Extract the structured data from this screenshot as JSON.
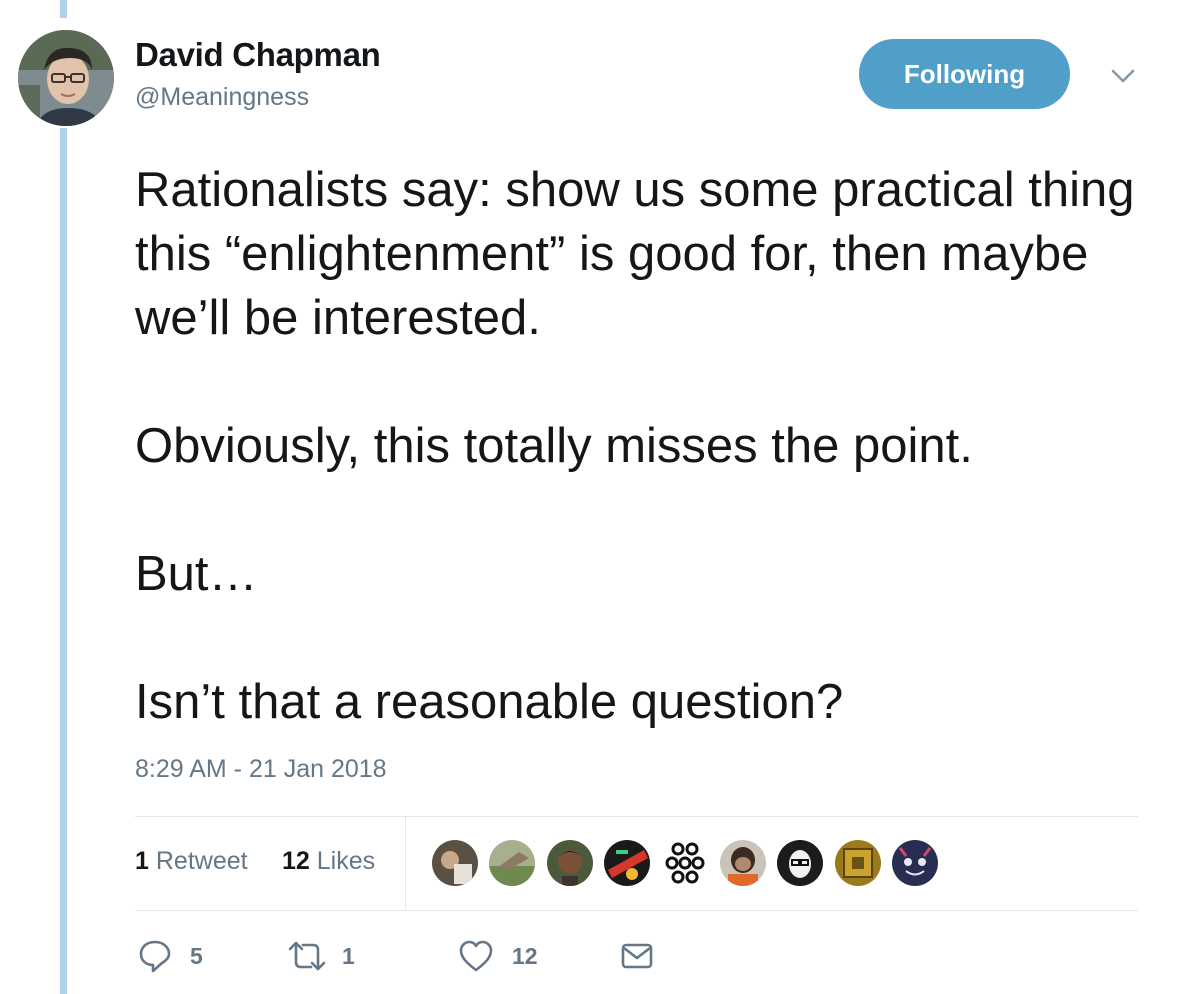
{
  "author": {
    "name": "David Chapman",
    "handle": "@Meaningness",
    "avatar_icon": "profile-photo"
  },
  "follow_button": {
    "label": "Following",
    "color": "#509fc8"
  },
  "menu": {
    "icon": "chevron-down-icon"
  },
  "tweet": {
    "paragraphs": [
      "Rationalists say: show us some practical thing this “enlightenment” is good for, then maybe we’ll be interested.",
      "Obviously, this totally misses the point.",
      "But…",
      "Isn’t that a reasonable question?"
    ]
  },
  "timestamp": "8:29 AM - 21 Jan 2018",
  "stats": {
    "retweets": {
      "count": "1",
      "label": "Retweet"
    },
    "likes": {
      "count": "12",
      "label": "Likes"
    }
  },
  "likers": [
    {
      "icon": "liker-avatar-1",
      "color": "#5a5044"
    },
    {
      "icon": "liker-avatar-2",
      "color": "#7a8a68"
    },
    {
      "icon": "liker-avatar-3",
      "color": "#3b3430"
    },
    {
      "icon": "liker-avatar-4",
      "color": "#1a1a1a"
    },
    {
      "icon": "liker-avatar-5",
      "color": "#ffffff"
    },
    {
      "icon": "liker-avatar-6",
      "color": "#8a6a55"
    },
    {
      "icon": "liker-avatar-7",
      "color": "#1c1c1c"
    },
    {
      "icon": "liker-avatar-8",
      "color": "#9a7a1a"
    },
    {
      "icon": "liker-avatar-9",
      "color": "#2a2d52"
    }
  ],
  "actions": {
    "reply": {
      "icon": "reply-icon",
      "count": "5"
    },
    "retweet": {
      "icon": "retweet-icon",
      "count": "1"
    },
    "like": {
      "icon": "heart-icon",
      "count": "12"
    },
    "message": {
      "icon": "envelope-icon"
    }
  },
  "colors": {
    "thread_line": "#aed2ea",
    "text": "#14171a",
    "secondary_text": "#657786",
    "divider": "#e1e8ed"
  }
}
